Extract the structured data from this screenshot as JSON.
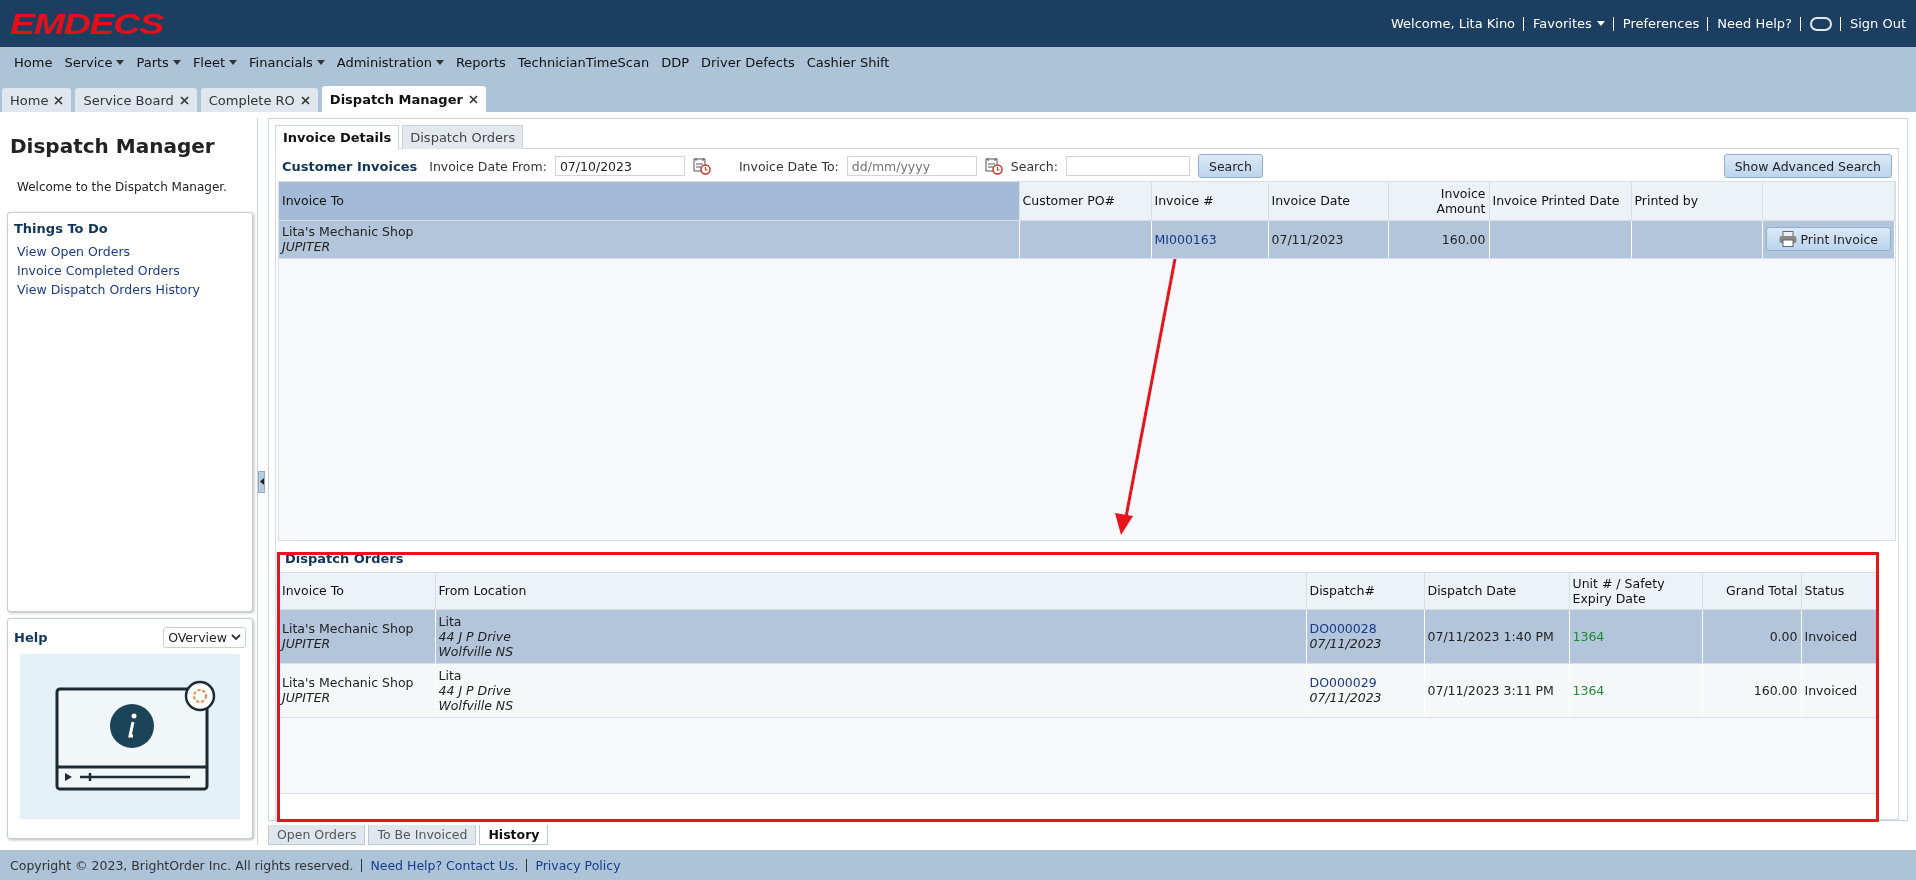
{
  "header": {
    "logo": "EMDECS",
    "welcome": "Welcome, Lita Kino",
    "links": [
      {
        "kind": "menu",
        "label": "Favorites"
      },
      {
        "kind": "link",
        "label": "Preferences"
      },
      {
        "kind": "link",
        "label": "Need Help?"
      },
      {
        "kind": "chat"
      },
      {
        "kind": "link",
        "label": "Sign Out"
      }
    ]
  },
  "menu": [
    {
      "label": "Home",
      "has_menu": false
    },
    {
      "label": "Service",
      "has_menu": true
    },
    {
      "label": "Parts",
      "has_menu": true
    },
    {
      "label": "Fleet",
      "has_menu": true
    },
    {
      "label": "Financials",
      "has_menu": true
    },
    {
      "label": "Administration",
      "has_menu": true
    },
    {
      "label": "Reports",
      "has_menu": false
    },
    {
      "label": "TechnicianTimeScan",
      "has_menu": false
    },
    {
      "label": "DDP",
      "has_menu": false
    },
    {
      "label": "Driver Defects",
      "has_menu": false
    },
    {
      "label": "Cashier Shift",
      "has_menu": false
    }
  ],
  "page_tabs": [
    {
      "label": "Home",
      "selected": false
    },
    {
      "label": "Service Board",
      "selected": false
    },
    {
      "label": "Complete RO",
      "selected": false
    },
    {
      "label": "Dispatch Manager",
      "selected": true
    }
  ],
  "sidebar": {
    "title": "Dispatch Manager",
    "welcome": "Welcome to the Dispatch Manager.",
    "things_to_do": {
      "title": "Things To Do",
      "links": [
        "View Open Orders",
        "Invoice Completed Orders",
        "View Dispatch Orders History"
      ]
    },
    "help": {
      "title": "Help",
      "topic": "OVerview"
    }
  },
  "invoice_tabs": [
    {
      "label": "Invoice Details",
      "selected": true
    },
    {
      "label": "Dispatch Orders",
      "selected": false
    }
  ],
  "customer_invoices": {
    "title": "Customer Invoices",
    "date_from_label": "Invoice Date From:",
    "date_from_value": "07/10/2023",
    "date_to_label": "Invoice Date To:",
    "date_to_placeholder": "dd/mm/yyyy",
    "search_label": "Search:",
    "search_button": "Search",
    "advanced_button": "Show Advanced Search",
    "columns": [
      "Invoice To",
      "Customer PO#",
      "Invoice #",
      "Invoice Date",
      "Invoice Amount",
      "Invoice Printed Date",
      "Printed by"
    ],
    "rows": [
      {
        "selected": true,
        "invoice_to": "Lita's Mechanic Shop",
        "customer": "JUPITER",
        "invoice_no": "MI000163",
        "invoice_date": "07/11/2023",
        "amount": "160.00",
        "action": "Print Invoice"
      }
    ]
  },
  "dispatch_orders": {
    "title": "Dispatch Orders",
    "columns": [
      "Invoice To",
      "From Location",
      "Dispatch#",
      "Dispatch Date",
      "Unit # / Safety Expiry Date",
      "Grand Total",
      "Status"
    ],
    "rows": [
      {
        "selected": true,
        "invoice_to": "Lita's Mechanic Shop",
        "customer": "JUPITER",
        "location_name": "Lita",
        "address": "44 J P Drive",
        "city": "Wolfville NS",
        "dispatch_no": "DO000028",
        "dispatch_no_date": "07/11/2023",
        "dispatch_date": "07/11/2023 1:40 PM",
        "unit": "1364",
        "grand_total": "0.00",
        "status": "Invoiced"
      },
      {
        "selected": false,
        "invoice_to": "Lita's Mechanic Shop",
        "customer": "JUPITER",
        "location_name": "Lita",
        "address": "44 J P Drive",
        "city": "Wolfville NS",
        "dispatch_no": "DO000029",
        "dispatch_no_date": "07/11/2023",
        "dispatch_date": "07/11/2023 3:11 PM",
        "unit": "1364",
        "grand_total": "160.00",
        "status": "Invoiced"
      }
    ]
  },
  "bottom_tabs": [
    {
      "label": "Open Orders",
      "selected": false
    },
    {
      "label": "To Be Invoiced",
      "selected": false
    },
    {
      "label": "History",
      "selected": true
    }
  ],
  "footer": {
    "copyright": "Copyright © 2023, BrightOrder Inc. All rights reserved.",
    "links": [
      "Need Help? Contact Us.",
      "Privacy Policy"
    ]
  }
}
